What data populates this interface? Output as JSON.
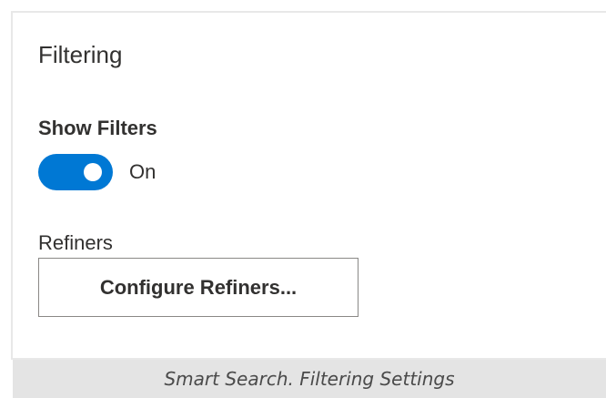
{
  "section": {
    "title": "Filtering"
  },
  "show_filters": {
    "label": "Show Filters",
    "state_text": "On",
    "enabled": true
  },
  "refiners": {
    "label": "Refiners",
    "button_label": "Configure Refiners..."
  },
  "caption": {
    "text": "Smart Search. Filtering Settings"
  },
  "colors": {
    "toggle_on": "#0078d4",
    "text": "#323130",
    "caption_bg": "#e4e4e4"
  }
}
